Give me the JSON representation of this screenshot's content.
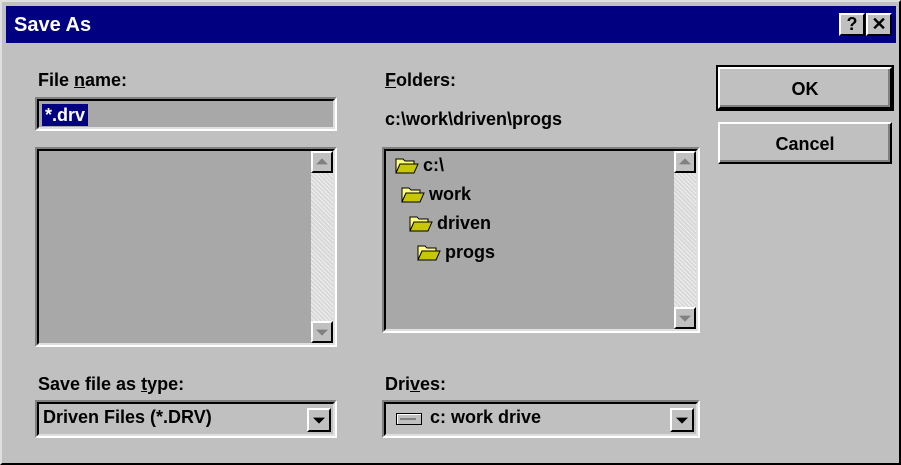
{
  "window": {
    "title": "Save As"
  },
  "title_buttons": {
    "help": "?",
    "close": "✕"
  },
  "file_name": {
    "label_pre": "File ",
    "label_underline": "n",
    "label_post": "ame:",
    "value": "*.drv"
  },
  "folders": {
    "label_underline": "F",
    "label_post": "olders:",
    "current_path": "c:\\work\\driven\\progs",
    "tree": [
      {
        "name": "c:\\"
      },
      {
        "name": "work"
      },
      {
        "name": "driven"
      },
      {
        "name": "progs"
      }
    ]
  },
  "buttons": {
    "ok": "OK",
    "cancel": "Cancel"
  },
  "save_type": {
    "label_pre": "Save file as ",
    "label_underline": "t",
    "label_post": "ype:",
    "value": "Driven Files (*.DRV)"
  },
  "drives": {
    "label_pre": "Dri",
    "label_underline": "v",
    "label_post": "es:",
    "value": "c: work drive"
  },
  "icons": {
    "folder": "folder-open-icon",
    "drive": "hard-drive-icon",
    "scroll_up": "scroll-up-arrow-icon",
    "scroll_down": "scroll-down-arrow-icon",
    "dropdown": "dropdown-arrow-icon"
  }
}
